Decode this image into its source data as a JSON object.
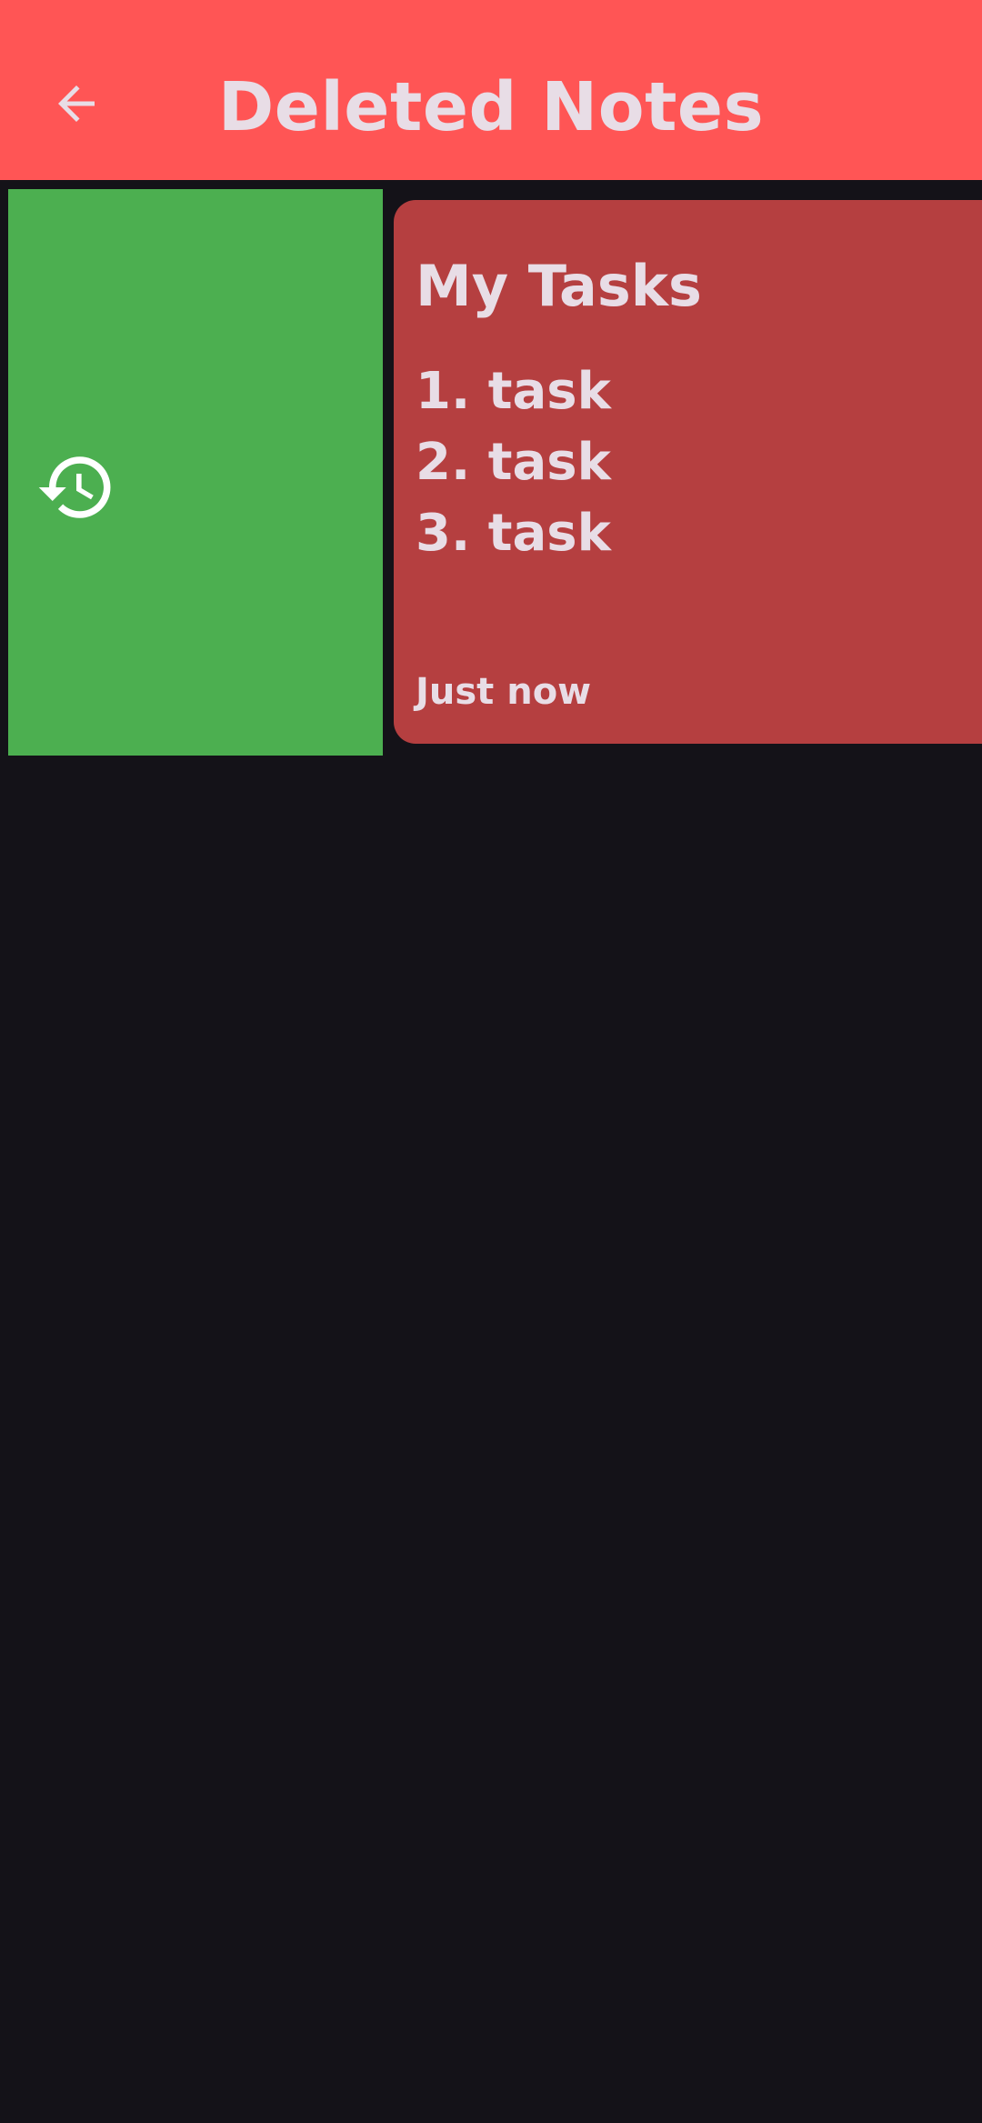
{
  "header": {
    "title": "Deleted Notes",
    "back_icon": "arrow-back-icon"
  },
  "swipe_action": {
    "icon": "restore-history-icon",
    "color": "#4caf50"
  },
  "notes": [
    {
      "title": "My Tasks",
      "body": "1. task\n2. task\n3. task",
      "timestamp": "Just now",
      "color": "#b53f40"
    }
  ],
  "colors": {
    "app_bar": "#ff5555",
    "background": "#141218",
    "text": "#e8dde6"
  }
}
